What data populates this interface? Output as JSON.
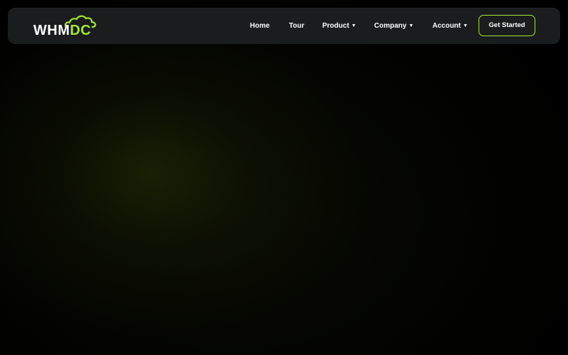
{
  "brand": {
    "logo_part1": "WHM",
    "logo_part2": "DC",
    "accent_color": "#a3e635",
    "logo_icon": "cloud-icon"
  },
  "nav": {
    "items": [
      {
        "label": "Home",
        "has_dropdown": false
      },
      {
        "label": "Tour",
        "has_dropdown": false
      },
      {
        "label": "Product",
        "has_dropdown": true
      },
      {
        "label": "Company",
        "has_dropdown": true
      },
      {
        "label": "Account",
        "has_dropdown": true
      }
    ],
    "dropdown_glyph": "▼",
    "cta_label": "Get Started"
  },
  "colors": {
    "background": "#000000",
    "navbar": "#1b1c1d",
    "text": "#ffffff"
  }
}
